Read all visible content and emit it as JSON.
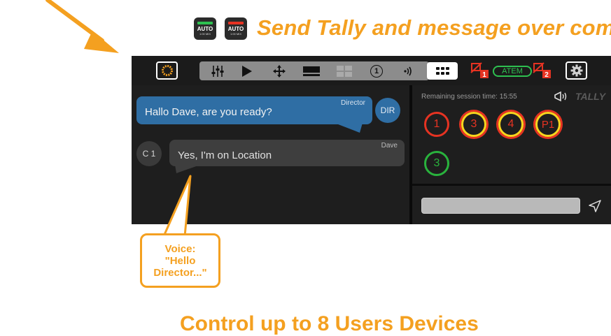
{
  "headline": "Send Tally and message over com",
  "auto_badges": [
    {
      "label": "AUTO",
      "sub": "1:00  MIX",
      "color": "#2ec050"
    },
    {
      "label": "AUTO",
      "sub": "1:00  MIX",
      "color": "#e63322"
    }
  ],
  "toolbar": {
    "icons": [
      "logo-spinner-icon",
      "mixer-sliders-icon",
      "play-icon",
      "move-arrows-icon",
      "lower-third-icon",
      "multiview-icon",
      "number-one-icon",
      "audio-wave-icon",
      "grid-dots-icon",
      "tally-1-icon",
      "tally-2-icon",
      "settings-gear-icon"
    ],
    "one_label": "1",
    "atem_label": "ATEM",
    "tally1_number": "1",
    "tally2_number": "2"
  },
  "chat": {
    "messages": [
      {
        "sender": "Director",
        "avatar": "DIR",
        "text": "Hallo Dave, are you ready?"
      },
      {
        "sender": "Dave",
        "avatar": "C 1",
        "text": "Yes, I'm on Location"
      }
    ]
  },
  "tally": {
    "remaining_label": "Remaining session time:",
    "remaining_time": "15:55",
    "label": "TALLY",
    "rings": [
      {
        "label": "1",
        "state": "program"
      },
      {
        "label": "3",
        "state": "program-preview"
      },
      {
        "label": "4",
        "state": "program-preview"
      },
      {
        "label": "P1",
        "state": "program-preview"
      },
      {
        "label": "3",
        "state": "preview"
      }
    ]
  },
  "message_input": {
    "value": "",
    "placeholder": ""
  },
  "callout": {
    "line1": "Voice:",
    "line2": "\"Hello",
    "line3": "Director...\""
  },
  "bottom_text": "Control up to 8 Users Devices",
  "colors": {
    "accent": "#f4a020",
    "director_bubble": "#2f6ea4",
    "tally_red": "#e63322",
    "tally_green": "#29b33d",
    "tally_yellow": "#f7d51e"
  }
}
